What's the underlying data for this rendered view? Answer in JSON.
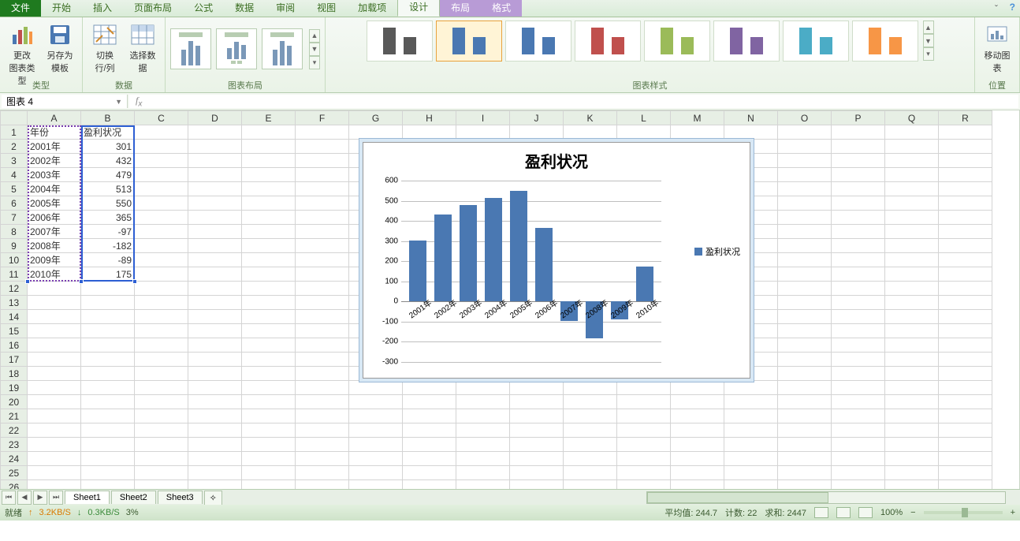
{
  "tabs": {
    "file": "文件",
    "items": [
      "开始",
      "插入",
      "页面布局",
      "公式",
      "数据",
      "审阅",
      "视图",
      "加载项"
    ],
    "context": [
      "设计",
      "布局",
      "格式"
    ],
    "active": "设计"
  },
  "ribbon": {
    "group_type": {
      "label": "类型",
      "change_type": "更改\n图表类型",
      "save_template": "另存为\n模板"
    },
    "group_data": {
      "label": "数据",
      "switch": "切换行/列",
      "select": "选择数据"
    },
    "group_layout": {
      "label": "图表布局"
    },
    "group_style": {
      "label": "图表样式",
      "colors": [
        [
          "#595959",
          "#595959"
        ],
        [
          "#4a78b2",
          "#4a78b2"
        ],
        [
          "#4a78b2",
          "#4a78b2"
        ],
        [
          "#c0504d",
          "#c0504d"
        ],
        [
          "#9bbb59",
          "#9bbb59"
        ],
        [
          "#8064a2",
          "#8064a2"
        ],
        [
          "#4bacc6",
          "#4bacc6"
        ],
        [
          "#f79646",
          "#f79646"
        ]
      ]
    },
    "group_pos": {
      "label": "位置",
      "move": "移动图表"
    }
  },
  "namebox": "图表 4",
  "columns": [
    "A",
    "B",
    "C",
    "D",
    "E",
    "F",
    "G",
    "H",
    "I",
    "J",
    "K",
    "L",
    "M",
    "N",
    "O",
    "P",
    "Q",
    "R"
  ],
  "table": {
    "headerA": "年份",
    "headerB": "盈利状况",
    "rows": [
      {
        "a": "2001年",
        "b": "301"
      },
      {
        "a": "2002年",
        "b": "432"
      },
      {
        "a": "2003年",
        "b": "479"
      },
      {
        "a": "2004年",
        "b": "513"
      },
      {
        "a": "2005年",
        "b": "550"
      },
      {
        "a": "2006年",
        "b": "365"
      },
      {
        "a": "2007年",
        "b": "-97"
      },
      {
        "a": "2008年",
        "b": "-182"
      },
      {
        "a": "2009年",
        "b": "-89"
      },
      {
        "a": "2010年",
        "b": "175"
      }
    ]
  },
  "chart_data": {
    "type": "bar",
    "title": "盈利状况",
    "legend": "盈利状况",
    "categories": [
      "2001年",
      "2002年",
      "2003年",
      "2004年",
      "2005年",
      "2006年",
      "2007年",
      "2008年",
      "2009年",
      "2010年"
    ],
    "values": [
      301,
      432,
      479,
      513,
      550,
      365,
      -97,
      -182,
      -89,
      175
    ],
    "ylim": [
      -300,
      600
    ],
    "ystep": 100,
    "xlabel": "",
    "ylabel": ""
  },
  "sheets": {
    "items": [
      "Sheet1",
      "Sheet2",
      "Sheet3"
    ],
    "active": "Sheet1"
  },
  "status": {
    "ready": "就绪",
    "net1": "3.2KB/S",
    "net2": "0.3KB/S",
    "pct": "3%",
    "avg_label": "平均值:",
    "avg": "244.7",
    "count_label": "计数:",
    "count": "22",
    "sum_label": "求和:",
    "sum": "2447",
    "zoom": "100%"
  }
}
